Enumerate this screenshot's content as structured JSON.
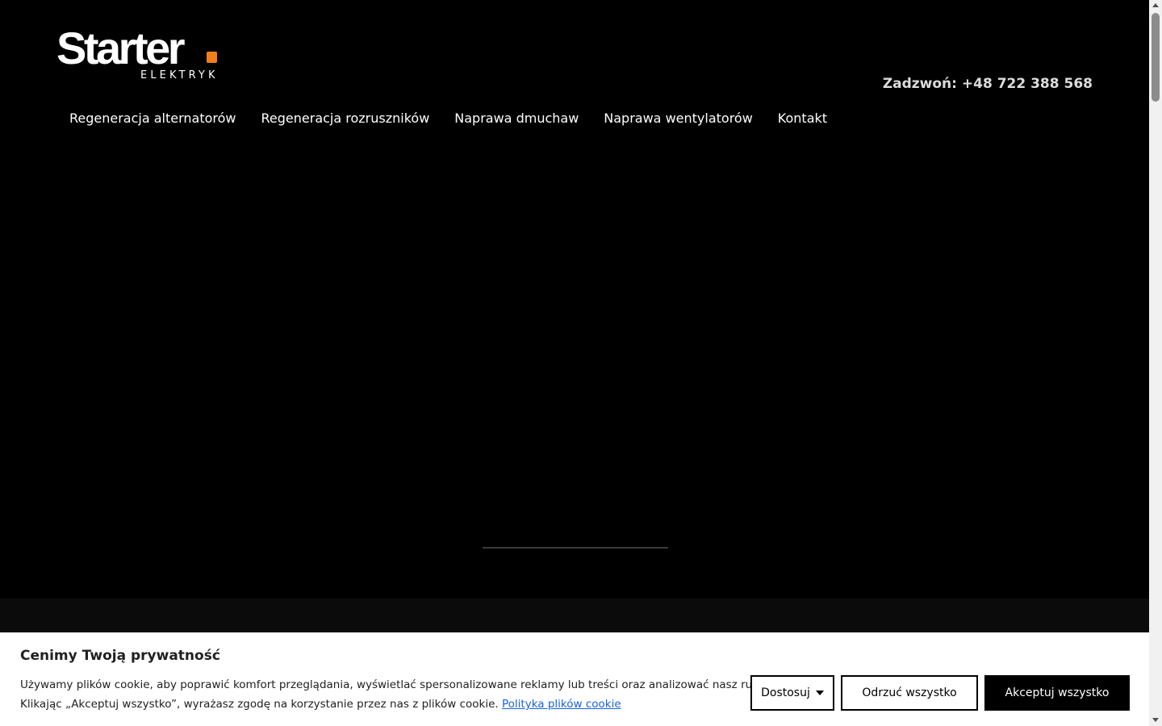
{
  "brand": {
    "logo_word": "Starter",
    "logo_sub": "ELEKTRYK",
    "accent": "#f07f1b"
  },
  "header": {
    "phone": "Zadzwoń: +48 722 388 568"
  },
  "nav": {
    "items": [
      {
        "label": "Regeneracja alternatorów"
      },
      {
        "label": "Regeneracja rozruszników"
      },
      {
        "label": "Naprawa dmuchaw"
      },
      {
        "label": "Naprawa wentylatorów"
      },
      {
        "label": "Kontakt"
      }
    ]
  },
  "cookie": {
    "title": "Cenimy Twoją prywatność",
    "line1": "Używamy plików cookie, aby poprawić komfort przeglądania, wyświetlać spersonalizowane reklamy lub treści oraz analizować nasz ruch.",
    "line2": "Klikając „Akceptuj wszystko”, wyrażasz zgodę na korzystanie przez nas z plików cookie.",
    "link": "Polityka plików cookie",
    "customize": "Dostosuj",
    "reject": "Odrzuć wszystko",
    "accept": "Akceptuj wszystko",
    "link_color": "#1863dc"
  }
}
